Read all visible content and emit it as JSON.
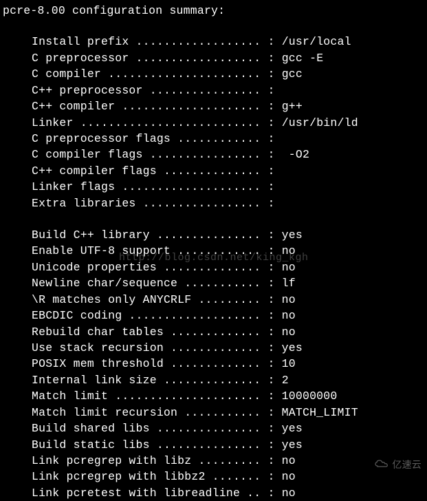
{
  "title": "pcre-8.00 configuration summary:",
  "watermark_text": "http://blog.csdn.net/king_kgh",
  "logo_text": "亿速云",
  "section1": [
    {
      "label": "Install prefix",
      "dots": " .................. : ",
      "value": "/usr/local"
    },
    {
      "label": "C preprocessor",
      "dots": " .................. : ",
      "value": "gcc -E"
    },
    {
      "label": "C compiler",
      "dots": " ...................... : ",
      "value": "gcc"
    },
    {
      "label": "C++ preprocessor",
      "dots": " ................ :",
      "value": ""
    },
    {
      "label": "C++ compiler",
      "dots": " .................... : ",
      "value": "g++"
    },
    {
      "label": "Linker",
      "dots": " .......................... : ",
      "value": "/usr/bin/ld"
    },
    {
      "label": "C preprocessor flags",
      "dots": " ............ :",
      "value": ""
    },
    {
      "label": "C compiler flags",
      "dots": " ................ : ",
      "value": " -O2"
    },
    {
      "label": "C++ compiler flags",
      "dots": " .............. :",
      "value": ""
    },
    {
      "label": "Linker flags",
      "dots": " .................... :",
      "value": ""
    },
    {
      "label": "Extra libraries",
      "dots": " ................. :",
      "value": ""
    }
  ],
  "section2": [
    {
      "label": "Build C++ library",
      "dots": " ............... : ",
      "value": "yes"
    },
    {
      "label": "Enable UTF-8 support",
      "dots": " ............ : ",
      "value": "no"
    },
    {
      "label": "Unicode properties",
      "dots": " .............. : ",
      "value": "no"
    },
    {
      "label": "Newline char/sequence",
      "dots": " ........... : ",
      "value": "lf"
    },
    {
      "label": "\\R matches only ANYCRLF",
      "dots": " ......... : ",
      "value": "no"
    },
    {
      "label": "EBCDIC coding",
      "dots": " ................... : ",
      "value": "no"
    },
    {
      "label": "Rebuild char tables",
      "dots": " ............. : ",
      "value": "no"
    },
    {
      "label": "Use stack recursion",
      "dots": " ............. : ",
      "value": "yes"
    },
    {
      "label": "POSIX mem threshold",
      "dots": " ............. : ",
      "value": "10"
    },
    {
      "label": "Internal link size",
      "dots": " .............. : ",
      "value": "2"
    },
    {
      "label": "Match limit",
      "dots": " ..................... : ",
      "value": "10000000"
    },
    {
      "label": "Match limit recursion",
      "dots": " ........... : ",
      "value": "MATCH_LIMIT"
    },
    {
      "label": "Build shared libs",
      "dots": " ............... : ",
      "value": "yes"
    },
    {
      "label": "Build static libs",
      "dots": " ............... : ",
      "value": "yes"
    },
    {
      "label": "Link pcregrep with libz",
      "dots": " ......... : ",
      "value": "no"
    },
    {
      "label": "Link pcregrep with libbz2",
      "dots": " ....... : ",
      "value": "no"
    },
    {
      "label": "Link pcretest with libreadline",
      "dots": " .. : ",
      "value": "no"
    }
  ]
}
